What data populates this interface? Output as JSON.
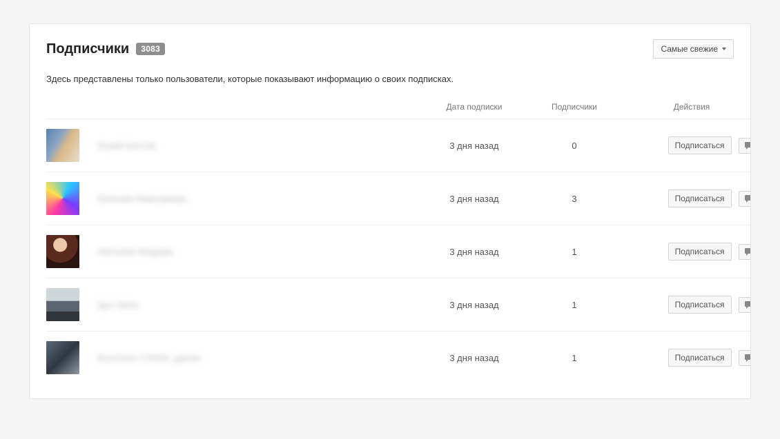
{
  "header": {
    "title": "Подписчики",
    "count": "3083",
    "sort_label": "Самые свежие",
    "description": "Здесь представлены только пользователи, которые показывают информацию о своих подписках."
  },
  "columns": {
    "date": "Дата подписки",
    "subs": "Подписчики",
    "actions": "Действия"
  },
  "action_labels": {
    "subscribe": "Подписаться"
  },
  "rows": [
    {
      "name": "Юрий Костик",
      "date": "3 дня назад",
      "subs": "0"
    },
    {
      "name": "Евгения Максимова",
      "date": "3 дня назад",
      "subs": "3"
    },
    {
      "name": "Наталия Медова",
      "date": "3 дня назад",
      "subs": "1"
    },
    {
      "name": "Igor Sirbu",
      "date": "3 дня назад",
      "subs": "1"
    },
    {
      "name": "Bunchies CANAL gamer",
      "date": "3 дня назад",
      "subs": "1"
    }
  ]
}
